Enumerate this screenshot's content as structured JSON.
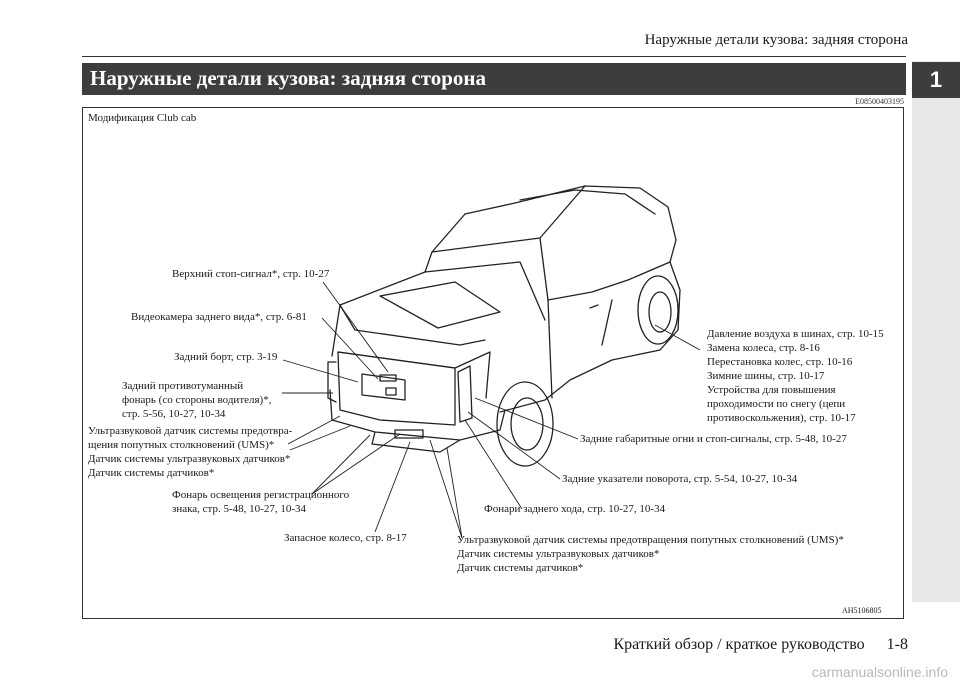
{
  "header": {
    "running_title": "Наружные детали кузова: задняя сторона"
  },
  "section": {
    "title": "Наружные детали кузова: задняя сторона",
    "chapter_number": "1",
    "doc_code": "E08500403195"
  },
  "figure": {
    "caption": "Модификация Club cab",
    "code": "AH5106805",
    "callouts": {
      "high_brake": [
        "Верхний стоп-сигнал*, стр. 10-27"
      ],
      "camera": [
        "Видеокамера заднего вида*, стр. 6-81"
      ],
      "tailgate": [
        "Задний борт, стр. 3-19"
      ],
      "rear_fog": [
        "Задний противотуманный",
        "фонарь (со стороны водителя)*,",
        "стр. 5-56, 10-27, 10-34"
      ],
      "ums_left": [
        "Ультразвуковой датчик системы предотвра-",
        "щения попутных столкновений (UMS)*",
        "Датчик системы ультразвуковых датчиков*",
        "Датчик системы датчиков*"
      ],
      "plate_light": [
        "Фонарь освещения регистрационного",
        "знака, стр. 5-48, 10-27, 10-34"
      ],
      "spare": [
        "Запасное колесо, стр. 8-17"
      ],
      "tires": [
        "Давление воздуха в шинах, стр. 10-15",
        "Замена колеса, стр. 8-16",
        "Перестановка колес, стр. 10-16",
        "Зимние шины, стр. 10-17",
        "Устройства для повышения",
        "проходимости по снегу (цепи",
        "противоскольжения), стр. 10-17"
      ],
      "tail_lights": [
        "Задние габаритные огни и стоп-сигналы, стр. 5-48, 10-27"
      ],
      "turn": [
        "Задние указатели поворота, стр. 5-54, 10-27, 10-34"
      ],
      "reverse": [
        "Фонари заднего хода, стр. 10-27, 10-34"
      ],
      "ums_bottom": [
        "Ультразвуковой датчик системы предотвращения попутных столкновений (UMS)*",
        "Датчик системы ультразвуковых датчиков*",
        "Датчик системы датчиков*"
      ]
    }
  },
  "footer": {
    "book_title": "Краткий обзор / краткое руководство",
    "page": "1-8"
  },
  "watermark": "carmanualsonline.info"
}
